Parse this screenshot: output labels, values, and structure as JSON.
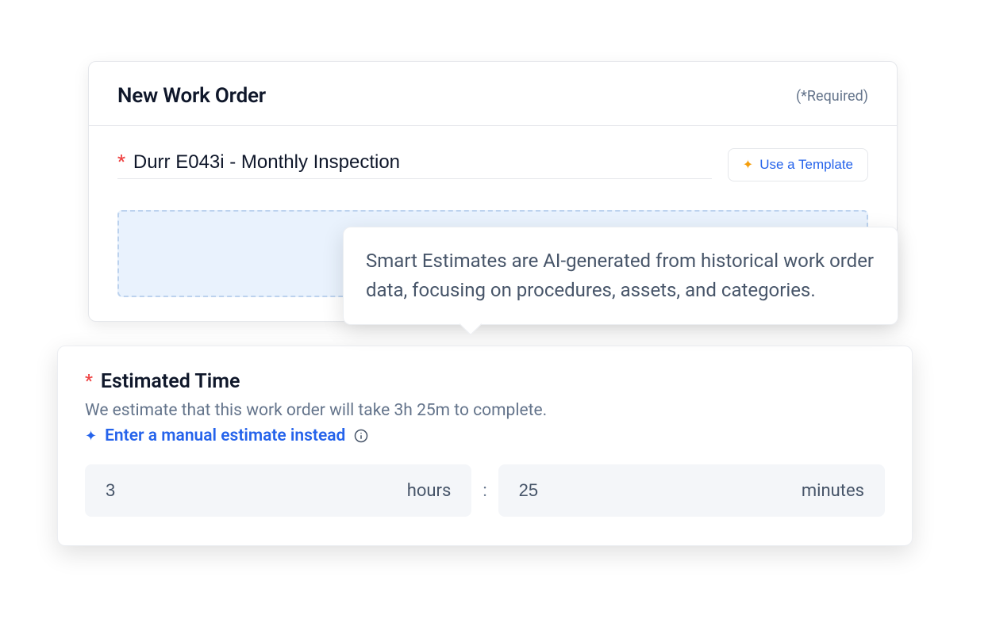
{
  "header": {
    "title": "New Work Order",
    "required_hint": "(*Required)"
  },
  "workorder": {
    "title_value": "Durr E043i - Monthly Inspection",
    "template_button": "Use a Template"
  },
  "tooltip": {
    "text": "Smart Estimates are AI-generated from historical work order data, focusing on procedures, assets, and categories."
  },
  "estimate": {
    "label": "Estimated Time",
    "subtext": "We estimate that this work order will take 3h 25m to complete.",
    "manual_link": "Enter a manual estimate instead",
    "hours_value": "3",
    "hours_unit": "hours",
    "minutes_value": "25",
    "minutes_unit": "minutes",
    "separator": ":"
  }
}
